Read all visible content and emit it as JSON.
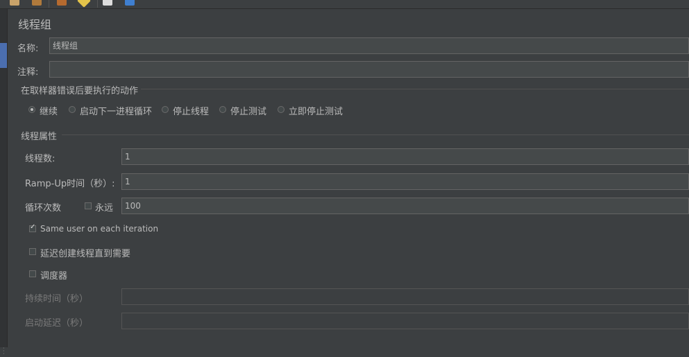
{
  "toolbar": {
    "icons": [
      "copy-icon",
      "paste-icon",
      "scissors-icon",
      "clear-icon",
      "file-icon",
      "help-icon"
    ]
  },
  "panel": {
    "title": "线程组",
    "name_label": "名称:",
    "name_value": "线程组",
    "comment_label": "注释:",
    "comment_value": ""
  },
  "error_action": {
    "group_title": "在取样器错误后要执行的动作",
    "options": [
      "继续",
      "启动下一进程循环",
      "停止线程",
      "停止测试",
      "立即停止测试"
    ],
    "selected": "继续"
  },
  "thread_props": {
    "group_title": "线程属性",
    "threads_label": "线程数:",
    "threads_value": "1",
    "rampup_label": "Ramp-Up时间（秒）:",
    "rampup_value": "1",
    "loop_label": "循环次数",
    "forever_label": "永远",
    "forever_checked": false,
    "loop_value": "100",
    "same_user_label": "Same user on each iteration",
    "same_user_checked": true,
    "delay_label": "延迟创建线程直到需要",
    "delay_checked": false,
    "scheduler_label": "调度器",
    "scheduler_checked": false,
    "duration_label": "持续时间（秒）",
    "duration_value": "",
    "startup_delay_label": "启动延迟（秒）",
    "startup_delay_value": ""
  },
  "colors": {
    "background": "#3c3f41",
    "field": "#45494a",
    "text": "#bbbbbb",
    "selection": "#4b6eaf"
  }
}
